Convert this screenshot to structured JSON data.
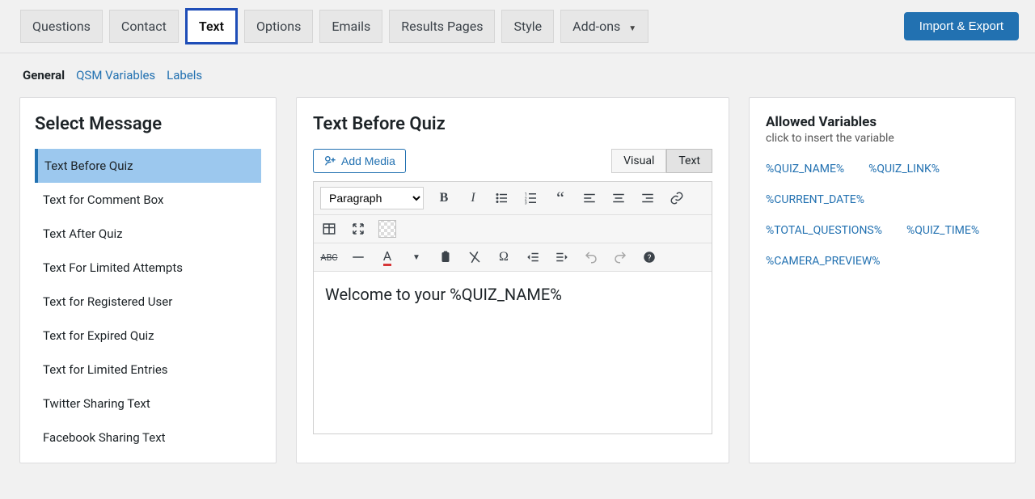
{
  "topbar": {
    "tabs": {
      "questions": "Questions",
      "contact": "Contact",
      "text": "Text",
      "options": "Options",
      "emails": "Emails",
      "results": "Results Pages",
      "style": "Style",
      "addons": "Add-ons"
    },
    "import_export": "Import & Export"
  },
  "subtabs": {
    "general": "General",
    "qsm_variables": "QSM Variables",
    "labels": "Labels"
  },
  "left": {
    "heading": "Select Message",
    "items": [
      "Text Before Quiz",
      "Text for Comment Box",
      "Text After Quiz",
      "Text For Limited Attempts",
      "Text for Registered User",
      "Text for Expired Quiz",
      "Text for Limited Entries",
      "Twitter Sharing Text",
      "Facebook Sharing Text"
    ],
    "selected_index": 0
  },
  "center": {
    "heading": "Text Before Quiz",
    "add_media": "Add Media",
    "mode_visual": "Visual",
    "mode_text": "Text",
    "format_select": "Paragraph",
    "content": "Welcome to your %QUIZ_NAME%"
  },
  "right": {
    "heading": "Allowed Variables",
    "hint": "click to insert the variable",
    "vars": [
      "%QUIZ_NAME%",
      "%QUIZ_LINK%",
      "%CURRENT_DATE%",
      "%TOTAL_QUESTIONS%",
      "%QUIZ_TIME%",
      "%CAMERA_PREVIEW%"
    ]
  }
}
